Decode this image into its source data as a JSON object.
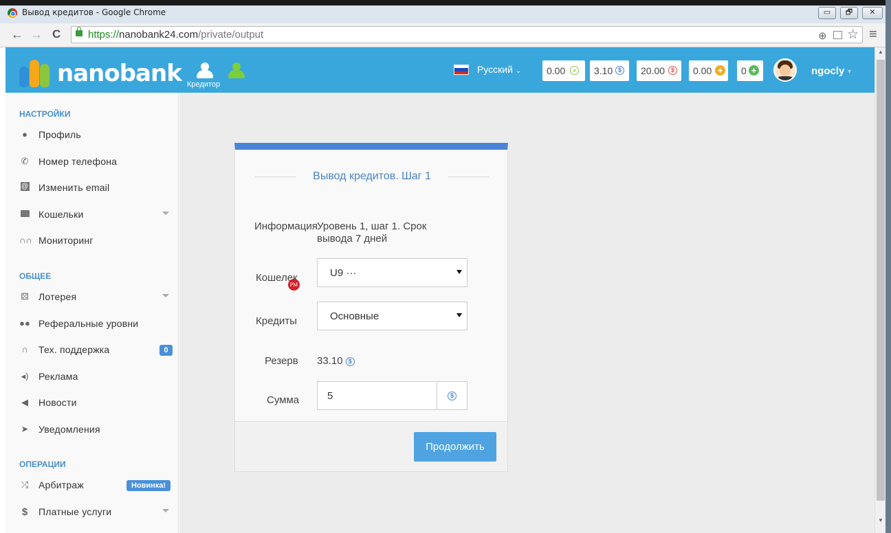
{
  "window": {
    "title": "Вывод кредитов - Google Chrome",
    "minimize_glyph": "▭",
    "restore_glyph": "🗗",
    "close_glyph": "✕"
  },
  "browser": {
    "url_scheme": "https://",
    "url_host": "nanobank24.com",
    "url_path": "/private/output",
    "back_glyph": "←",
    "forward_glyph": "→",
    "reload_glyph": "C",
    "zoom_glyph": "⊕",
    "star_glyph": "☆",
    "menu_glyph": "≡"
  },
  "header": {
    "logo_text": "nanobank",
    "role_label": "Кредитор",
    "language": "Русский",
    "balances": [
      {
        "value": "0.00",
        "icon": "play-circle-icon"
      },
      {
        "value": "3.10",
        "icon": "usd-blue-icon"
      },
      {
        "value": "20.00",
        "icon": "usd-red-icon"
      },
      {
        "value": "0.00",
        "icon": "plus-orange-icon"
      },
      {
        "value": "0",
        "icon": "plus-green-icon"
      }
    ],
    "username": "ngocly"
  },
  "sidebar": {
    "sections": [
      {
        "title": "НАСТРОЙКИ",
        "items": [
          {
            "label": "Профиль",
            "icon": "user-icon"
          },
          {
            "label": "Номер телефона",
            "icon": "phone-icon"
          },
          {
            "label": "Изменить email",
            "icon": "at-icon"
          },
          {
            "label": "Кошельки",
            "icon": "wallet-icon"
          },
          {
            "label": "Мониторинг",
            "icon": "binoculars-icon"
          }
        ]
      },
      {
        "title": "ОБЩЕЕ",
        "items": [
          {
            "label": "Лотерея",
            "icon": "dice-icon"
          },
          {
            "label": "Реферальные уровни",
            "icon": "users-icon"
          },
          {
            "label": "Тех. поддержка",
            "icon": "headset-icon",
            "badge": "0"
          },
          {
            "label": "Реклама",
            "icon": "volume-icon"
          },
          {
            "label": "Новости",
            "icon": "bullhorn-icon"
          },
          {
            "label": "Уведомления",
            "icon": "send-icon"
          }
        ]
      },
      {
        "title": "ОПЕРАЦИИ",
        "items": [
          {
            "label": "Арбитраж",
            "icon": "shuffle-icon",
            "badge": "Новинка!"
          },
          {
            "label": "Платные услуги",
            "icon": "dollar-icon"
          }
        ]
      }
    ]
  },
  "form": {
    "title": "Вывод кредитов. Шаг 1",
    "info_label": "Информация",
    "info_line1": "Уровень 1, шаг 1. Срок",
    "info_line2": "вывода 7 дней",
    "wallet_label": "Кошелек",
    "wallet_badge": "PM",
    "wallet_value": "U9 ···",
    "credits_label": "Кредиты",
    "credits_value": "Основные",
    "reserve_label": "Резерв",
    "reserve_value": "33.10",
    "amount_label": "Сумма",
    "amount_value": "5",
    "continue_label": "Продолжить",
    "usd_glyph": "$"
  },
  "colors": {
    "header_bg": "#3aa7dc",
    "accent_blue": "#4a84d5",
    "button_blue": "#4fa3e1"
  }
}
